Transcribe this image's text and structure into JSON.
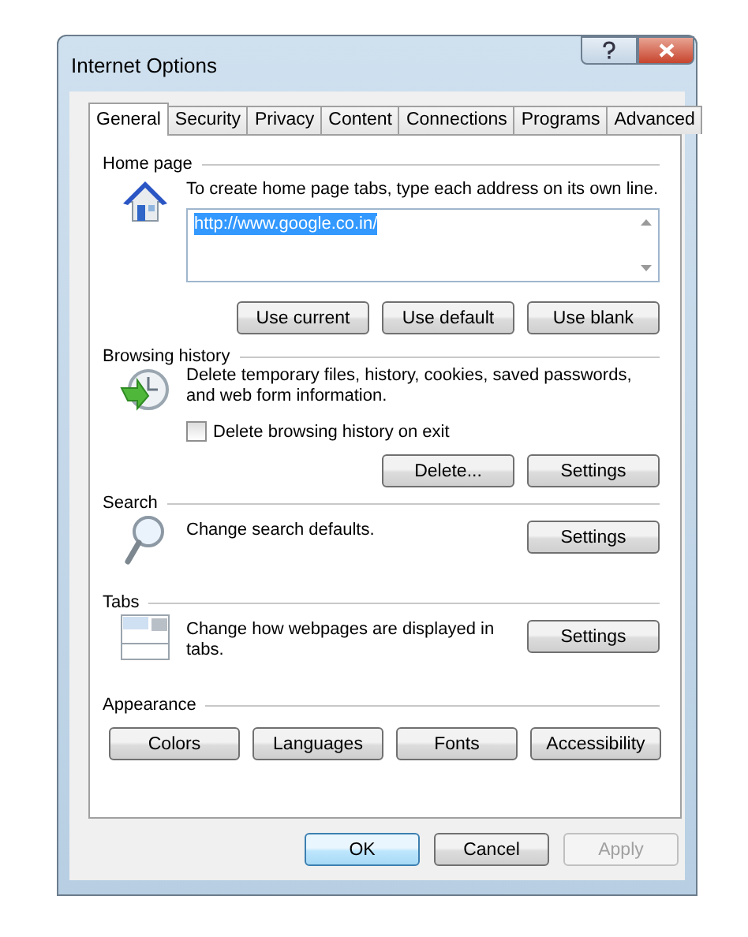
{
  "window": {
    "title": "Internet Options"
  },
  "tabs": [
    {
      "label": "General",
      "selected": true
    },
    {
      "label": "Security",
      "selected": false
    },
    {
      "label": "Privacy",
      "selected": false
    },
    {
      "label": "Content",
      "selected": false
    },
    {
      "label": "Connections",
      "selected": false
    },
    {
      "label": "Programs",
      "selected": false
    },
    {
      "label": "Advanced",
      "selected": false
    }
  ],
  "sections": [
    {
      "kind": "home",
      "title": "Home page",
      "description": "To create home page tabs, type each address on its own line.",
      "addresses": {
        "value": "http://www.google.co.in/",
        "selected": true
      },
      "buttons": [
        "Use current",
        "Use default",
        "Use blank"
      ]
    },
    {
      "kind": "history",
      "title": "Browsing history",
      "description": "Delete temporary files, history, cookies, saved passwords, and web form information.",
      "checkbox": {
        "label": "Delete browsing history on exit",
        "checked": false
      },
      "buttons": [
        "Delete...",
        "Settings"
      ]
    },
    {
      "kind": "search",
      "title": "Search",
      "description": "Change search defaults.",
      "buttons": [
        "Settings"
      ]
    },
    {
      "kind": "tabs",
      "title": "Tabs",
      "description": "Change how webpages are displayed in tabs.",
      "buttons": [
        "Settings"
      ]
    },
    {
      "kind": "appearance",
      "title": "Appearance",
      "buttons": [
        "Colors",
        "Languages",
        "Fonts",
        "Accessibility"
      ]
    }
  ],
  "footer_buttons": [
    {
      "label": "OK",
      "default": true,
      "disabled": false
    },
    {
      "label": "Cancel",
      "default": false,
      "disabled": false
    },
    {
      "label": "Apply",
      "default": false,
      "disabled": true
    }
  ]
}
